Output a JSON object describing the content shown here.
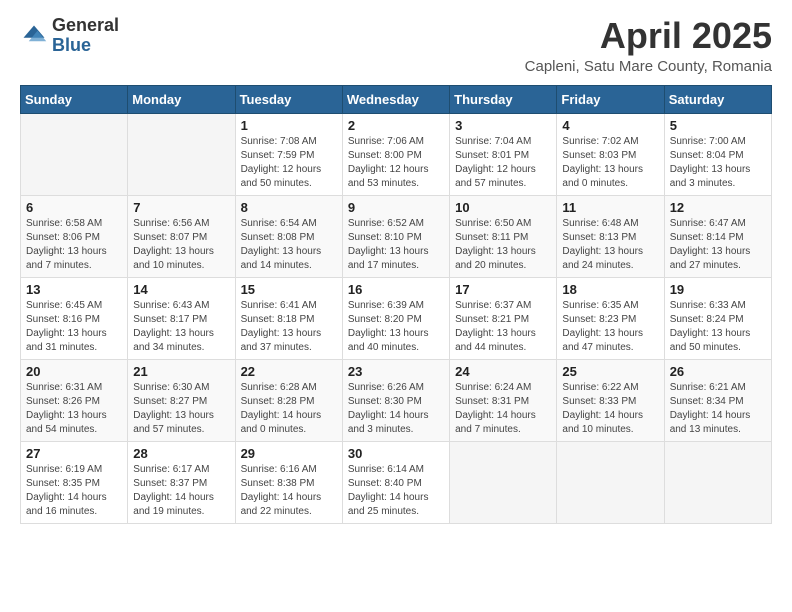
{
  "header": {
    "logo_general": "General",
    "logo_blue": "Blue",
    "month_year": "April 2025",
    "location": "Capleni, Satu Mare County, Romania"
  },
  "days_of_week": [
    "Sunday",
    "Monday",
    "Tuesday",
    "Wednesday",
    "Thursday",
    "Friday",
    "Saturday"
  ],
  "weeks": [
    [
      {
        "day": "",
        "sunrise": "",
        "sunset": "",
        "daylight": ""
      },
      {
        "day": "",
        "sunrise": "",
        "sunset": "",
        "daylight": ""
      },
      {
        "day": "1",
        "sunrise": "Sunrise: 7:08 AM",
        "sunset": "Sunset: 7:59 PM",
        "daylight": "Daylight: 12 hours and 50 minutes."
      },
      {
        "day": "2",
        "sunrise": "Sunrise: 7:06 AM",
        "sunset": "Sunset: 8:00 PM",
        "daylight": "Daylight: 12 hours and 53 minutes."
      },
      {
        "day": "3",
        "sunrise": "Sunrise: 7:04 AM",
        "sunset": "Sunset: 8:01 PM",
        "daylight": "Daylight: 12 hours and 57 minutes."
      },
      {
        "day": "4",
        "sunrise": "Sunrise: 7:02 AM",
        "sunset": "Sunset: 8:03 PM",
        "daylight": "Daylight: 13 hours and 0 minutes."
      },
      {
        "day": "5",
        "sunrise": "Sunrise: 7:00 AM",
        "sunset": "Sunset: 8:04 PM",
        "daylight": "Daylight: 13 hours and 3 minutes."
      }
    ],
    [
      {
        "day": "6",
        "sunrise": "Sunrise: 6:58 AM",
        "sunset": "Sunset: 8:06 PM",
        "daylight": "Daylight: 13 hours and 7 minutes."
      },
      {
        "day": "7",
        "sunrise": "Sunrise: 6:56 AM",
        "sunset": "Sunset: 8:07 PM",
        "daylight": "Daylight: 13 hours and 10 minutes."
      },
      {
        "day": "8",
        "sunrise": "Sunrise: 6:54 AM",
        "sunset": "Sunset: 8:08 PM",
        "daylight": "Daylight: 13 hours and 14 minutes."
      },
      {
        "day": "9",
        "sunrise": "Sunrise: 6:52 AM",
        "sunset": "Sunset: 8:10 PM",
        "daylight": "Daylight: 13 hours and 17 minutes."
      },
      {
        "day": "10",
        "sunrise": "Sunrise: 6:50 AM",
        "sunset": "Sunset: 8:11 PM",
        "daylight": "Daylight: 13 hours and 20 minutes."
      },
      {
        "day": "11",
        "sunrise": "Sunrise: 6:48 AM",
        "sunset": "Sunset: 8:13 PM",
        "daylight": "Daylight: 13 hours and 24 minutes."
      },
      {
        "day": "12",
        "sunrise": "Sunrise: 6:47 AM",
        "sunset": "Sunset: 8:14 PM",
        "daylight": "Daylight: 13 hours and 27 minutes."
      }
    ],
    [
      {
        "day": "13",
        "sunrise": "Sunrise: 6:45 AM",
        "sunset": "Sunset: 8:16 PM",
        "daylight": "Daylight: 13 hours and 31 minutes."
      },
      {
        "day": "14",
        "sunrise": "Sunrise: 6:43 AM",
        "sunset": "Sunset: 8:17 PM",
        "daylight": "Daylight: 13 hours and 34 minutes."
      },
      {
        "day": "15",
        "sunrise": "Sunrise: 6:41 AM",
        "sunset": "Sunset: 8:18 PM",
        "daylight": "Daylight: 13 hours and 37 minutes."
      },
      {
        "day": "16",
        "sunrise": "Sunrise: 6:39 AM",
        "sunset": "Sunset: 8:20 PM",
        "daylight": "Daylight: 13 hours and 40 minutes."
      },
      {
        "day": "17",
        "sunrise": "Sunrise: 6:37 AM",
        "sunset": "Sunset: 8:21 PM",
        "daylight": "Daylight: 13 hours and 44 minutes."
      },
      {
        "day": "18",
        "sunrise": "Sunrise: 6:35 AM",
        "sunset": "Sunset: 8:23 PM",
        "daylight": "Daylight: 13 hours and 47 minutes."
      },
      {
        "day": "19",
        "sunrise": "Sunrise: 6:33 AM",
        "sunset": "Sunset: 8:24 PM",
        "daylight": "Daylight: 13 hours and 50 minutes."
      }
    ],
    [
      {
        "day": "20",
        "sunrise": "Sunrise: 6:31 AM",
        "sunset": "Sunset: 8:26 PM",
        "daylight": "Daylight: 13 hours and 54 minutes."
      },
      {
        "day": "21",
        "sunrise": "Sunrise: 6:30 AM",
        "sunset": "Sunset: 8:27 PM",
        "daylight": "Daylight: 13 hours and 57 minutes."
      },
      {
        "day": "22",
        "sunrise": "Sunrise: 6:28 AM",
        "sunset": "Sunset: 8:28 PM",
        "daylight": "Daylight: 14 hours and 0 minutes."
      },
      {
        "day": "23",
        "sunrise": "Sunrise: 6:26 AM",
        "sunset": "Sunset: 8:30 PM",
        "daylight": "Daylight: 14 hours and 3 minutes."
      },
      {
        "day": "24",
        "sunrise": "Sunrise: 6:24 AM",
        "sunset": "Sunset: 8:31 PM",
        "daylight": "Daylight: 14 hours and 7 minutes."
      },
      {
        "day": "25",
        "sunrise": "Sunrise: 6:22 AM",
        "sunset": "Sunset: 8:33 PM",
        "daylight": "Daylight: 14 hours and 10 minutes."
      },
      {
        "day": "26",
        "sunrise": "Sunrise: 6:21 AM",
        "sunset": "Sunset: 8:34 PM",
        "daylight": "Daylight: 14 hours and 13 minutes."
      }
    ],
    [
      {
        "day": "27",
        "sunrise": "Sunrise: 6:19 AM",
        "sunset": "Sunset: 8:35 PM",
        "daylight": "Daylight: 14 hours and 16 minutes."
      },
      {
        "day": "28",
        "sunrise": "Sunrise: 6:17 AM",
        "sunset": "Sunset: 8:37 PM",
        "daylight": "Daylight: 14 hours and 19 minutes."
      },
      {
        "day": "29",
        "sunrise": "Sunrise: 6:16 AM",
        "sunset": "Sunset: 8:38 PM",
        "daylight": "Daylight: 14 hours and 22 minutes."
      },
      {
        "day": "30",
        "sunrise": "Sunrise: 6:14 AM",
        "sunset": "Sunset: 8:40 PM",
        "daylight": "Daylight: 14 hours and 25 minutes."
      },
      {
        "day": "",
        "sunrise": "",
        "sunset": "",
        "daylight": ""
      },
      {
        "day": "",
        "sunrise": "",
        "sunset": "",
        "daylight": ""
      },
      {
        "day": "",
        "sunrise": "",
        "sunset": "",
        "daylight": ""
      }
    ]
  ]
}
